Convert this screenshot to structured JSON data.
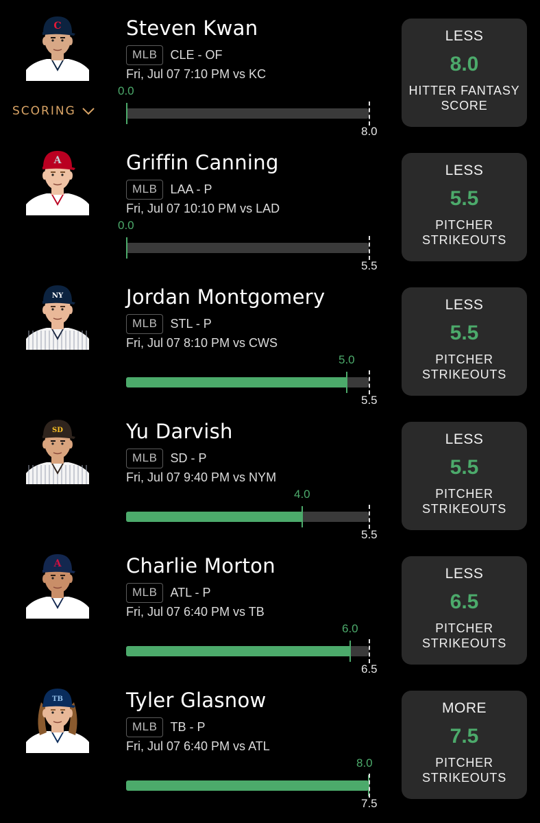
{
  "scoring_toggle": {
    "label": "SCORING"
  },
  "picks": [
    {
      "name": "Steven Kwan",
      "league": "MLB",
      "team_pos": "CLE - OF",
      "game": "Fri, Jul 07 7:10 PM  vs KC",
      "actual": 0.0,
      "actual_label": "0.0",
      "line": 8.0,
      "line_label": "8.0",
      "direction": "LESS",
      "value": "8.0",
      "stat_line1": "HITTER FANTASY",
      "stat_line2": "SCORE",
      "cap_color": "#0c2340",
      "logo_color": "#e31937",
      "logo_glyph": "C",
      "skin": "#d8a886",
      "hair": "#1a1410",
      "jersey_stripe": "#ffffff",
      "jersey_accent": "#0c2340"
    },
    {
      "name": "Griffin Canning",
      "league": "MLB",
      "team_pos": "LAA - P",
      "game": "Fri, Jul 07 10:10 PM  vs LAD",
      "actual": 0.0,
      "actual_label": "0.0",
      "line": 5.5,
      "line_label": "5.5",
      "direction": "LESS",
      "value": "5.5",
      "stat_line1": "PITCHER",
      "stat_line2": "STRIKEOUTS",
      "cap_color": "#ba0021",
      "logo_color": "#c4ced4",
      "logo_glyph": "A",
      "skin": "#efc2a4",
      "hair": "#7a4f2b",
      "jersey_stripe": "#ffffff",
      "jersey_accent": "#ba0021"
    },
    {
      "name": "Jordan Montgomery",
      "league": "MLB",
      "team_pos": "STL - P",
      "game": "Fri, Jul 07 8:10 PM  vs CWS",
      "actual": 5.0,
      "actual_label": "5.0",
      "line": 5.5,
      "line_label": "5.5",
      "direction": "LESS",
      "value": "5.5",
      "stat_line1": "PITCHER",
      "stat_line2": "STRIKEOUTS",
      "cap_color": "#0c2340",
      "logo_color": "#ffffff",
      "logo_glyph": "NY",
      "skin": "#e9b898",
      "hair": "#4a3020",
      "jersey_stripe": "#f4f4f4",
      "jersey_accent": "#1c2841"
    },
    {
      "name": "Yu Darvish",
      "league": "MLB",
      "team_pos": "SD - P",
      "game": "Fri, Jul 07 9:40 PM  vs NYM",
      "actual": 4.0,
      "actual_label": "4.0",
      "line": 5.5,
      "line_label": "5.5",
      "direction": "LESS",
      "value": "5.5",
      "stat_line1": "PITCHER",
      "stat_line2": "STRIKEOUTS",
      "cap_color": "#2f241d",
      "logo_color": "#ffc425",
      "logo_glyph": "SD",
      "skin": "#d9a47e",
      "hair": "#151010",
      "jersey_stripe": "#f4f4f4",
      "jersey_accent": "#2f241d"
    },
    {
      "name": "Charlie Morton",
      "league": "MLB",
      "team_pos": "ATL - P",
      "game": "Fri, Jul 07 6:40 PM  vs TB",
      "actual": 6.0,
      "actual_label": "6.0",
      "line": 6.5,
      "line_label": "6.5",
      "direction": "LESS",
      "value": "6.5",
      "stat_line1": "PITCHER",
      "stat_line2": "STRIKEOUTS",
      "cap_color": "#13274f",
      "logo_color": "#ce1141",
      "logo_glyph": "A",
      "skin": "#c98e68",
      "hair": "#2a1c14",
      "jersey_stripe": "#ffffff",
      "jersey_accent": "#13274f"
    },
    {
      "name": "Tyler Glasnow",
      "league": "MLB",
      "team_pos": "TB - P",
      "game": "Fri, Jul 07 6:40 PM  vs ATL",
      "actual": 8.0,
      "actual_label": "8.0",
      "line": 7.5,
      "line_label": "7.5",
      "direction": "MORE",
      "value": "7.5",
      "stat_line1": "PITCHER",
      "stat_line2": "STRIKEOUTS",
      "cap_color": "#092c5c",
      "logo_color": "#8fbce6",
      "logo_glyph": "TB",
      "skin": "#e8b898",
      "hair": "#8a5a2e",
      "jersey_stripe": "#ffffff",
      "jersey_accent": "#092c5c"
    }
  ]
}
